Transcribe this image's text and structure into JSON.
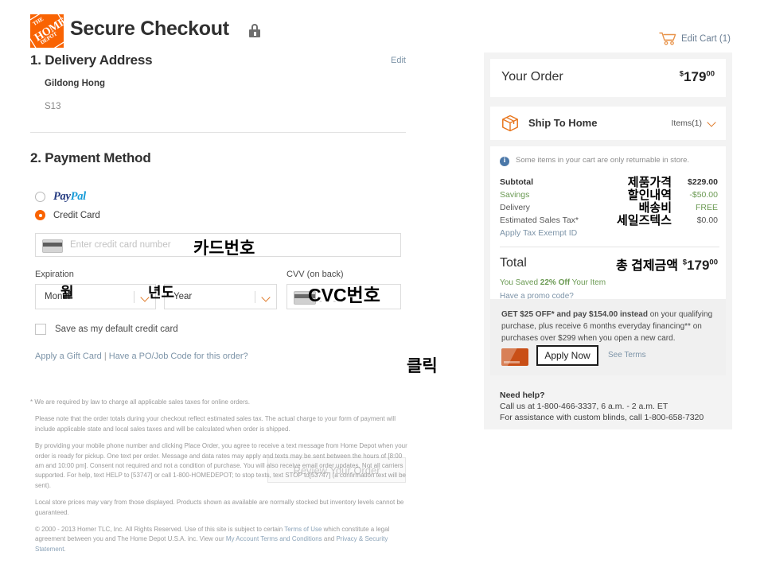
{
  "header": {
    "logo_lines": [
      "THE",
      "HOME",
      "DEPOT"
    ],
    "title": "Secure Checkout",
    "lock_icon": "lock-icon",
    "edit_cart_label": "Edit Cart (1)",
    "cart_icon": "shopping-cart-icon",
    "accent_color": "#f96302",
    "link_color": "#7d94a8"
  },
  "delivery": {
    "heading": "1. Delivery Address",
    "edit_label": "Edit",
    "name": "Gildong Hong",
    "address": "S13"
  },
  "payment": {
    "heading": "2. Payment Method",
    "paypal_label_a": "Pay",
    "paypal_label_b": "Pal",
    "credit_card_label": "Credit Card",
    "card_number_placeholder": "Enter credit card number",
    "expiration_label": "Expiration",
    "cvv_label": "CVV (on back)",
    "month_value": "Month",
    "year_value": "Year",
    "cvv_dashes": "- - - -",
    "save_card_label": "Save as my default credit card",
    "gift_card_link": "Apply a Gift Card",
    "link_separator": "|",
    "po_job_link": "Have a PO/Job Code for this order?",
    "review_button": "Review Your Order"
  },
  "annotations": {
    "card_number": "카드번호",
    "month": "월",
    "year": "년도",
    "cvc": "CVC번호",
    "click": "클릭",
    "subtotal": "제품가격",
    "savings": "할인내역",
    "delivery": "배송비",
    "sales_tax": "세일즈텍스",
    "total": "총  겹제금액"
  },
  "order": {
    "title": "Your Order",
    "amount_currency": "$",
    "amount_dollars": "179",
    "amount_cents": "00",
    "ship_method": "Ship To Home",
    "ship_icon": "package-box-icon",
    "items_label": "Items(1)",
    "chevron_icon": "chevron-down-icon",
    "info_icon": "info-circle-icon",
    "info_notice": "Some items in your cart are only returnable in store.",
    "lines": [
      {
        "label": "Subtotal",
        "value": "$229.00",
        "style": "bold"
      },
      {
        "label": "Savings",
        "value": "-$50.00",
        "style": "green"
      },
      {
        "label": "Delivery",
        "value": "FREE",
        "style": "free"
      },
      {
        "label": "Estimated Sales Tax*",
        "value": "$0.00",
        "style": "grey"
      },
      {
        "label": "Apply Tax Exempt ID",
        "value": "",
        "style": "link"
      }
    ],
    "total_label": "Total",
    "total_currency": "$",
    "total_dollars": "179",
    "total_cents": "00",
    "saved_prefix": "You Saved ",
    "saved_amount": "22% Off",
    "saved_suffix": " Your Item",
    "promo_link": "Have a promo code?"
  },
  "offer": {
    "bold_part": "GET $25 OFF* and pay $154.00 instead",
    "rest": " on your qualifying purchase, plus receive 6 months everyday financing** on purchases over $299 when you open a new card.",
    "card_icon": "credit-card-image",
    "apply_button": "Apply Now",
    "see_terms": "See Terms"
  },
  "help": {
    "heading": "Need help?",
    "line1": "Call us at 1-800-466-3337, 6 a.m. - 2 a.m. ET",
    "line2": "For assistance with custom blinds, call 1-800-658-7320"
  },
  "legal": {
    "p1": "* We are required by law to charge all applicable sales taxes for online orders.",
    "p2": "Please note that the order totals during your checkout reflect estimated sales tax. The actual charge to your form of payment will include applicable state and local sales taxes and will be calculated when order is shipped.",
    "p3": "By providing your mobile phone number and clicking Place Order, you agree to receive a text message from Home Depot when your order is ready for pickup. One text per order. Message and data rates may apply and texts may be sent between the hours of [8:00 am and 10:00 pm]. Consent not required and not a condition of purchase. You will also receive email order updates. Not all carriers supported. For help, text HELP to [53747] or call 1-800-HOMEDEPOT; to stop texts, text STOP to[53747] (a confirmation text will be sent).",
    "p4": "Local store prices may vary from those displayed. Products shown as available are normally stocked but inventory levels cannot be guaranteed.",
    "copyright_1": "© 2000 - 2013 Homer TLC, Inc. All Rights Reserved. Use of this site is subject to certain ",
    "terms_of_use": "Terms of Use",
    "copyright_2": " which constitute a legal agreement between you and The Home Depot U.S.A. inc. View our ",
    "account_terms": "My Account Terms and Conditions",
    "copyright_3": " and ",
    "privacy": "Privacy & Security Statement",
    "copyright_4": "."
  }
}
